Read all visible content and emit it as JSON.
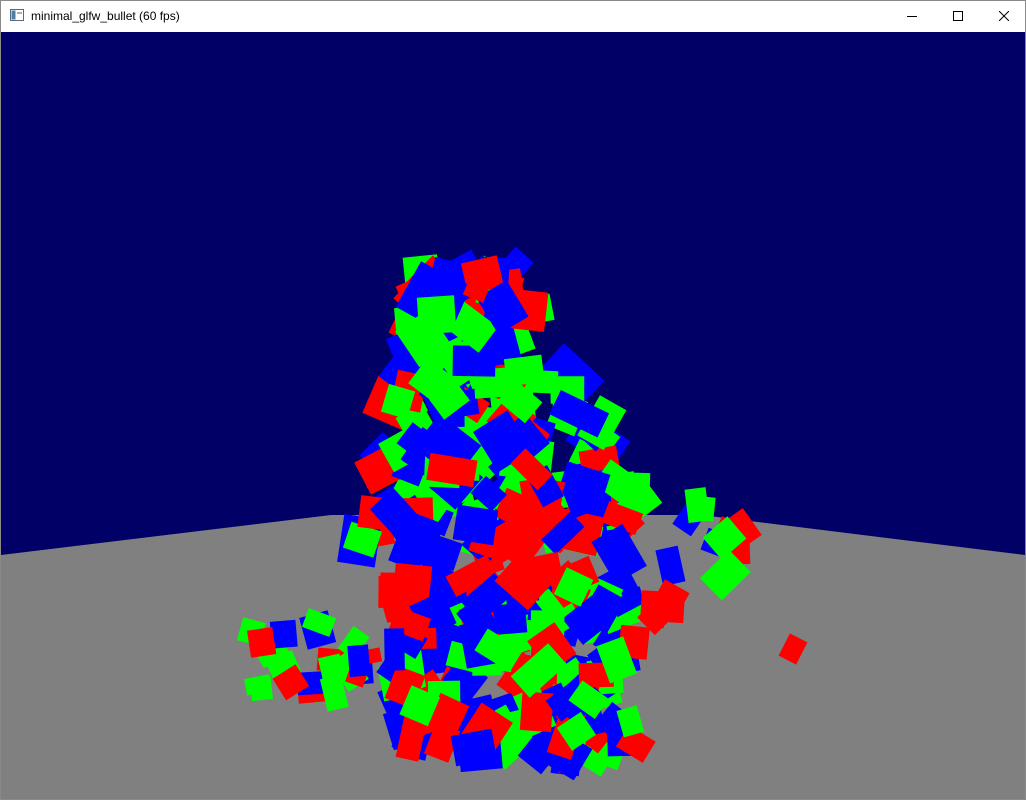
{
  "window": {
    "title": "minimal_glfw_bullet (60 fps)",
    "controls": {
      "minimize": "minimize-icon",
      "maximize": "maximize-icon",
      "close": "close-icon"
    }
  },
  "scene": {
    "sky_color": "#000066",
    "ground_color": "#808080",
    "box_colors": [
      "#ff0000",
      "#00ff00",
      "#0000ff"
    ]
  }
}
